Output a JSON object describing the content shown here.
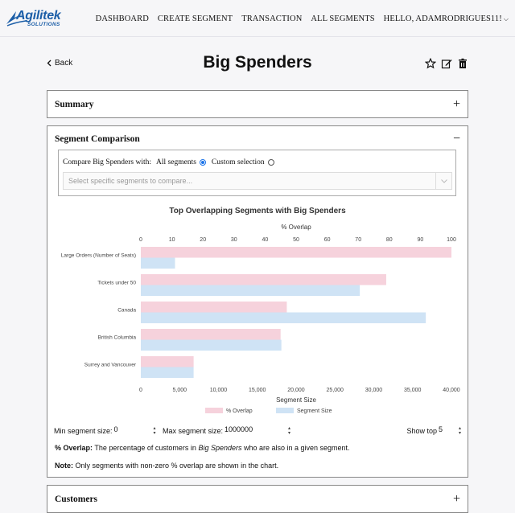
{
  "nav": {
    "logo_text": "Agilitek",
    "logo_sub": "SOLUTIONS",
    "links": [
      "DASHBOARD",
      "CREATE SEGMENT",
      "TRANSACTION",
      "ALL SEGMENTS"
    ],
    "user": "HELLO, ADAMRODRIGUES11!"
  },
  "page": {
    "back_label": "Back",
    "title": "Big Spenders"
  },
  "summary": {
    "title": "Summary",
    "toggle": "+"
  },
  "comparison": {
    "title": "Segment Comparison",
    "toggle": "−",
    "compare_label": "Compare Big Spenders with:",
    "option_all": "All segments",
    "option_custom": "Custom selection",
    "select_placeholder": "Select specific segments to compare...",
    "controls": {
      "min_label": "Min segment size:",
      "min_value": "0",
      "max_label": "Max segment size:",
      "max_value": "1000000",
      "top_label": "Show top",
      "top_value": "5"
    },
    "overlap_note_label": "% Overlap:",
    "overlap_note_pre": " The percentage of customers in ",
    "overlap_note_em": "Big Spenders",
    "overlap_note_post": " who are also in a given segment.",
    "note_label": "Note:",
    "note_text": " Only segments with non-zero % overlap are shown in the chart."
  },
  "customers": {
    "title": "Customers",
    "toggle": "+"
  },
  "chart_data": {
    "type": "bar",
    "orientation": "horizontal",
    "title": "Top Overlapping Segments with Big Spenders",
    "categories": [
      "Large Orders (Number of Seats)",
      "Tickets under 50",
      "Canada",
      "British Columbia",
      "Surrey and Vancouver"
    ],
    "series": [
      {
        "name": "% Overlap",
        "axis": "top",
        "values": [
          100,
          79,
          47,
          45,
          17
        ],
        "color": "#f6d2dc"
      },
      {
        "name": "Segment Size",
        "axis": "bottom",
        "values": [
          4400,
          28200,
          36700,
          18100,
          6800
        ],
        "color": "#cfe3f5"
      }
    ],
    "top_axis": {
      "label": "% Overlap",
      "range": [
        0,
        100
      ],
      "ticks": [
        "0",
        "10",
        "20",
        "30",
        "40",
        "50",
        "60",
        "70",
        "80",
        "90",
        "100"
      ]
    },
    "bottom_axis": {
      "label": "Segment Size",
      "range": [
        0,
        40000
      ],
      "ticks": [
        "0",
        "5,000",
        "10,000",
        "15,000",
        "20,000",
        "25,000",
        "30,000",
        "35,000",
        "40,000"
      ]
    },
    "legend_placement": "bottom"
  }
}
